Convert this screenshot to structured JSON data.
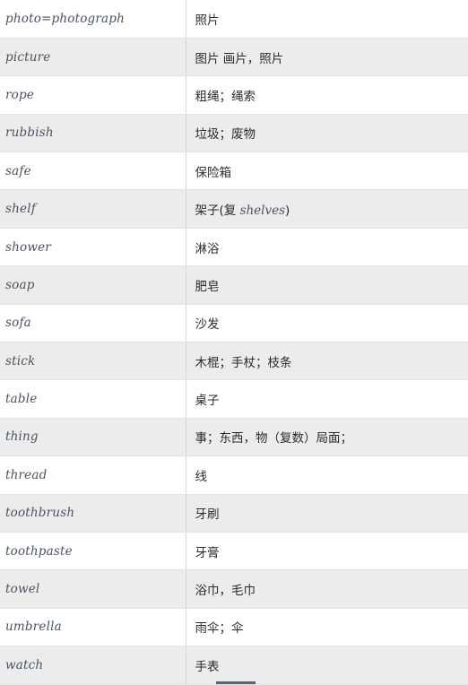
{
  "table": {
    "columns": [
      {
        "key": "term",
        "name": "english-term"
      },
      {
        "key": "gloss",
        "name": "chinese-gloss"
      }
    ],
    "rows": [
      {
        "term": "photo=photograph",
        "gloss": "照片"
      },
      {
        "term": "picture",
        "gloss": "图片 画片，照片"
      },
      {
        "term": "rope",
        "gloss": "粗绳；绳索"
      },
      {
        "term": "rubbish",
        "gloss": "垃圾；废物"
      },
      {
        "term": "safe",
        "gloss": "保险箱"
      },
      {
        "term": "shelf",
        "gloss": "架子(复 shelves)",
        "gloss_prefix": "架子(复 ",
        "gloss_latin": "shelves",
        "gloss_suffix": ")"
      },
      {
        "term": "shower",
        "gloss": "淋浴"
      },
      {
        "term": "soap",
        "gloss": "肥皂"
      },
      {
        "term": "sofa",
        "gloss": "沙发"
      },
      {
        "term": "stick",
        "gloss": "木棍；手杖；枝条"
      },
      {
        "term": "table",
        "gloss": "桌子"
      },
      {
        "term": "thing",
        "gloss": "事；东西，物（复数）局面；"
      },
      {
        "term": "thread",
        "gloss": "线"
      },
      {
        "term": "toothbrush",
        "gloss": "牙刷"
      },
      {
        "term": "toothpaste",
        "gloss": "牙膏"
      },
      {
        "term": "towel",
        "gloss": "浴巾，毛巾"
      },
      {
        "term": "umbrella",
        "gloss": "雨伞；伞"
      },
      {
        "term": "watch",
        "gloss": "手表"
      }
    ]
  },
  "colors": {
    "row_odd_background": "#ffffff",
    "row_even_background": "#ececec",
    "row_divider": "#e3e3e3",
    "column_divider": "#d8d8d8",
    "term_text": "#4a5361",
    "gloss_text": "#2b2b2b",
    "bottom_bar": "#5c636e"
  }
}
